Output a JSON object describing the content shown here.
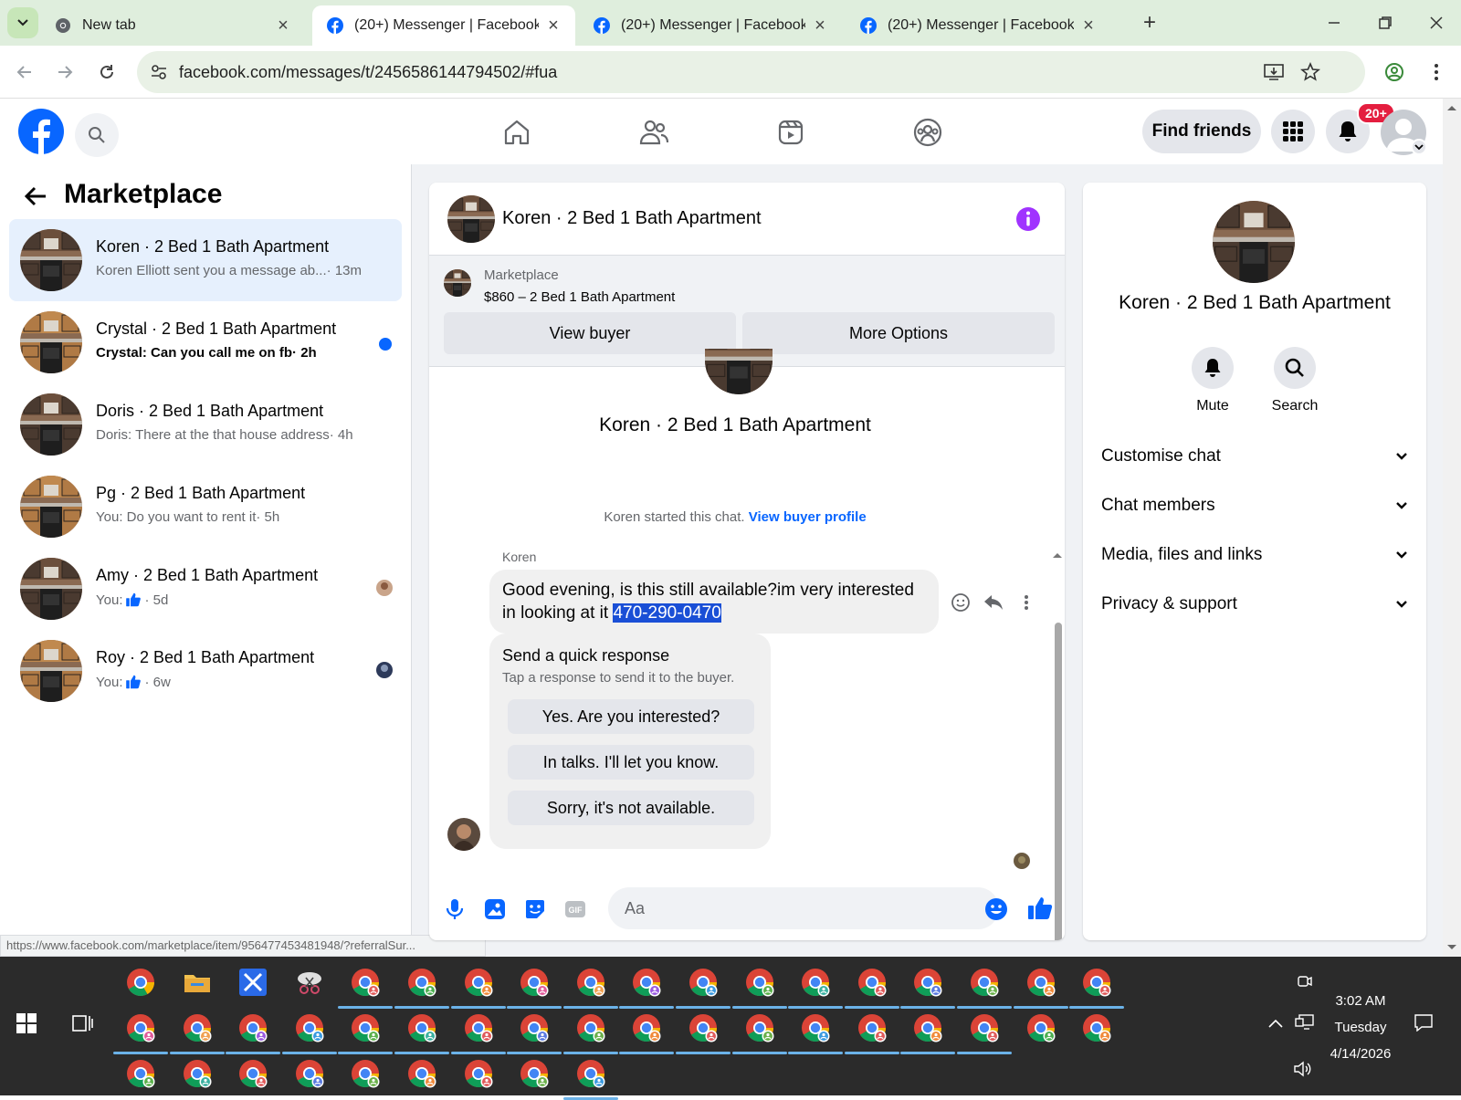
{
  "browser": {
    "tabs": [
      {
        "title": "New tab",
        "favicon": "chrome-icon",
        "active": false
      },
      {
        "title": "(20+) Messenger | Facebook",
        "favicon": "facebook-icon",
        "active": true
      },
      {
        "title": "(20+) Messenger | Facebook",
        "favicon": "facebook-icon",
        "active": false
      },
      {
        "title": "(20+) Messenger | Facebook",
        "favicon": "facebook-icon",
        "active": false
      }
    ],
    "url": "facebook.com/messages/t/2456586144794502/#fua",
    "status_url": "https://www.facebook.com/marketplace/item/956477453481948/?referralSur..."
  },
  "fb_header": {
    "find_friends": "Find friends",
    "notifications_badge": "20+",
    "brand_color": "#0866ff"
  },
  "sidebar": {
    "title": "Marketplace",
    "conversations": [
      {
        "name": "Koren · 2 Bed 1 Bath Apartment",
        "preview": "Koren Elliott sent you a message ab...",
        "time": " · 13m",
        "active": true,
        "unread": false
      },
      {
        "name": "Crystal · 2 Bed 1 Bath Apartment",
        "preview": "Crystal: Can you call me on fb",
        "time": " · 2h",
        "active": false,
        "unread": true
      },
      {
        "name": "Doris · 2 Bed 1 Bath Apartment",
        "preview": "Doris: There at the that house address",
        "time": " · 4h",
        "active": false,
        "unread": false
      },
      {
        "name": "Pg · 2 Bed 1 Bath Apartment",
        "preview": "You: Do you want to rent it",
        "time": " · 5h",
        "active": false,
        "unread": false
      },
      {
        "name": "Amy · 2 Bed 1 Bath Apartment",
        "preview": "You: ",
        "time": " · 5d",
        "active": false,
        "unread": false
      },
      {
        "name": "Roy · 2 Bed 1 Bath Apartment",
        "preview": "You: ",
        "time": " · 6w",
        "active": false,
        "unread": false
      }
    ]
  },
  "chat": {
    "title": "Koren · 2 Bed 1 Bath Apartment",
    "marketplace_label": "Marketplace",
    "listing": "$860 – 2 Bed 1 Bath Apartment",
    "view_buyer": "View buyer",
    "more_options": "More Options",
    "thread_title": "Koren · 2 Bed 1 Bath Apartment",
    "started_text": "Koren started this chat.",
    "view_buyer_profile": "View buyer profile",
    "sender": "Koren",
    "message_text": "Good evening, is this still available?im very interested in looking at it ",
    "message_phone": "470-290-0470",
    "quick_title": "Send a quick response",
    "quick_sub": "Tap a response to send it to the buyer.",
    "quick_responses": [
      "Yes. Are you interested?",
      "In talks. I'll let you know.",
      "Sorry, it's not available."
    ],
    "input_placeholder": "Aa"
  },
  "right_panel": {
    "name": "Koren · 2 Bed 1 Bath Apartment",
    "mute": "Mute",
    "search": "Search",
    "sections": [
      "Customise chat",
      "Chat members",
      "Media, files and links",
      "Privacy & support"
    ]
  },
  "taskbar": {
    "time": "3:02 AM",
    "day": "Tuesday",
    "date": "4/14/2026"
  }
}
